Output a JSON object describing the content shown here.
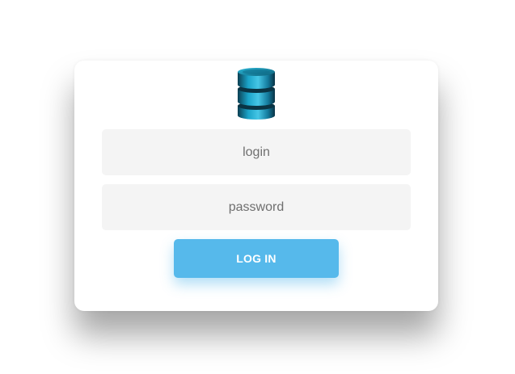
{
  "login_form": {
    "logo_icon": "database-icon",
    "login_field": {
      "value": "",
      "placeholder": "login"
    },
    "password_field": {
      "value": "",
      "placeholder": "password"
    },
    "submit_label": "LOG IN"
  },
  "colors": {
    "button": "#56b9eb",
    "field_background": "#f4f4f4",
    "logo": "#1a8fb0"
  }
}
